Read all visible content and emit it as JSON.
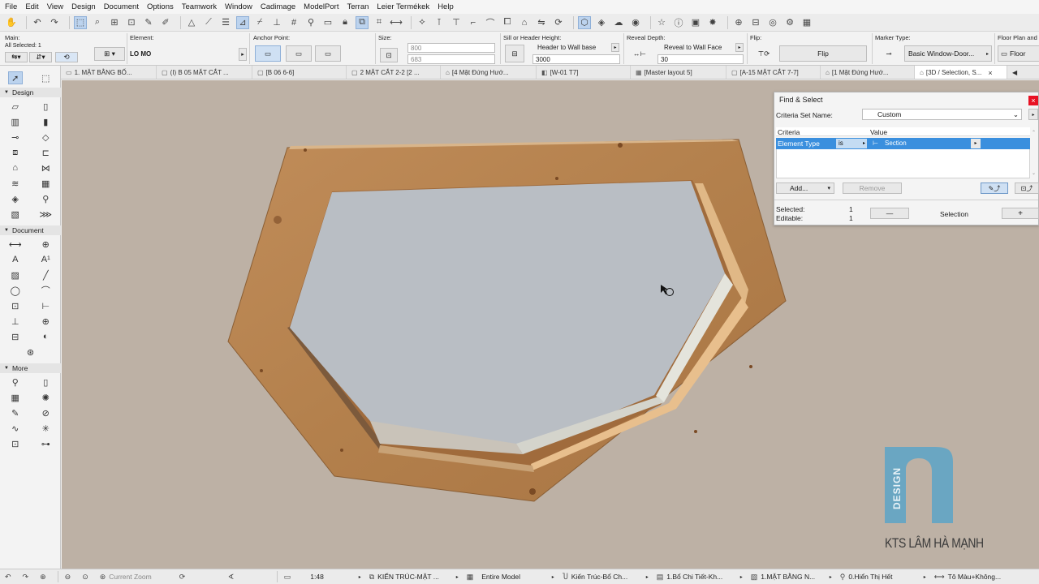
{
  "menu": [
    "File",
    "Edit",
    "View",
    "Design",
    "Document",
    "Options",
    "Teamwork",
    "Window",
    "Cadimage",
    "ModelPort",
    "Terran",
    "Leier Termékek",
    "Help"
  ],
  "infobox": {
    "main_label": "Main:",
    "all_selected": "All Selected: 1",
    "element_label": "Element:",
    "element_value": "LO MO",
    "anchor_label": "Anchor Point:",
    "size_label": "Size:",
    "size_width": "800",
    "size_height": "683",
    "sill_label": "Sill or Header Height:",
    "sill_mode": "Header to Wall base",
    "sill_value": "3000",
    "reveal_label": "Reveal Depth:",
    "reveal_mode": "Reveal to Wall Face",
    "reveal_value": "30",
    "flip_label": "Flip:",
    "flip_button": "Flip",
    "marker_label": "Marker Type:",
    "marker_value": "Basic Window-Door...",
    "floor_label": "Floor Plan and S",
    "floor_value": "Floor"
  },
  "tabs": [
    {
      "icon": "floorplan-icon",
      "label": "1. MẶT BẰNG BỐ..."
    },
    {
      "icon": "section-icon",
      "label": "(I) B 05 MẶT CẮT ..."
    },
    {
      "icon": "section-icon",
      "label": "[B 06 6-6]"
    },
    {
      "icon": "section-icon",
      "label": "2 MẶT CẮT 2-2 [2 ..."
    },
    {
      "icon": "elevation-icon",
      "label": "[4 Mặt Đứng Hướ..."
    },
    {
      "icon": "detail-icon",
      "label": "[W-01 T7]"
    },
    {
      "icon": "layout-icon",
      "label": "[Master layout 5]"
    },
    {
      "icon": "section-icon",
      "label": "[A-15 MẶT CẮT 7-7]"
    },
    {
      "icon": "elevation-icon",
      "label": "[1 Mặt Đứng Hướ..."
    },
    {
      "icon": "3d-icon",
      "label": "[3D / Selection, S...",
      "active": true,
      "close": "×"
    }
  ],
  "toolbox": {
    "design_label": "Design",
    "document_label": "Document",
    "more_label": "More"
  },
  "find_select": {
    "title": "Find & Select",
    "criteria_set_label": "Criteria Set Name:",
    "criteria_set_value": "Custom",
    "col_criteria": "Criteria",
    "col_value": "Value",
    "row_criteria": "Element Type",
    "row_operator": "is",
    "row_value": "Section",
    "add_button": "Add...",
    "remove_button": "Remove",
    "selected_label": "Selected:",
    "selected_value": "1",
    "editable_label": "Editable:",
    "editable_value": "1",
    "minus_button": "—",
    "selection_label": "Selection",
    "plus_button": "+"
  },
  "statusbar": {
    "zoom_label": "Current Zoom",
    "scale": "1:48",
    "layer_combo": "KIẾN TRÚC-MẶT ...",
    "model_view": "Entire Model",
    "pen_set": "Kiến Trúc-Bổ Ch...",
    "mvo": "1.Bổ Chi Tiết-Kh...",
    "renovation": "1.MẶT BẰNG N...",
    "graphic_override": "0.Hiển Thị Hết",
    "dimension": "Tô Màu+Không..."
  },
  "watermark": {
    "logo_text": "DESIGN",
    "caption": "KTS LÂM HÀ MẠNH",
    "color": "#6aa6c2"
  },
  "colors": {
    "viewport_bg": "#bdb1a5",
    "wood": "#b88453",
    "glass": "#b9bec4",
    "selection": "#3a8fde"
  }
}
